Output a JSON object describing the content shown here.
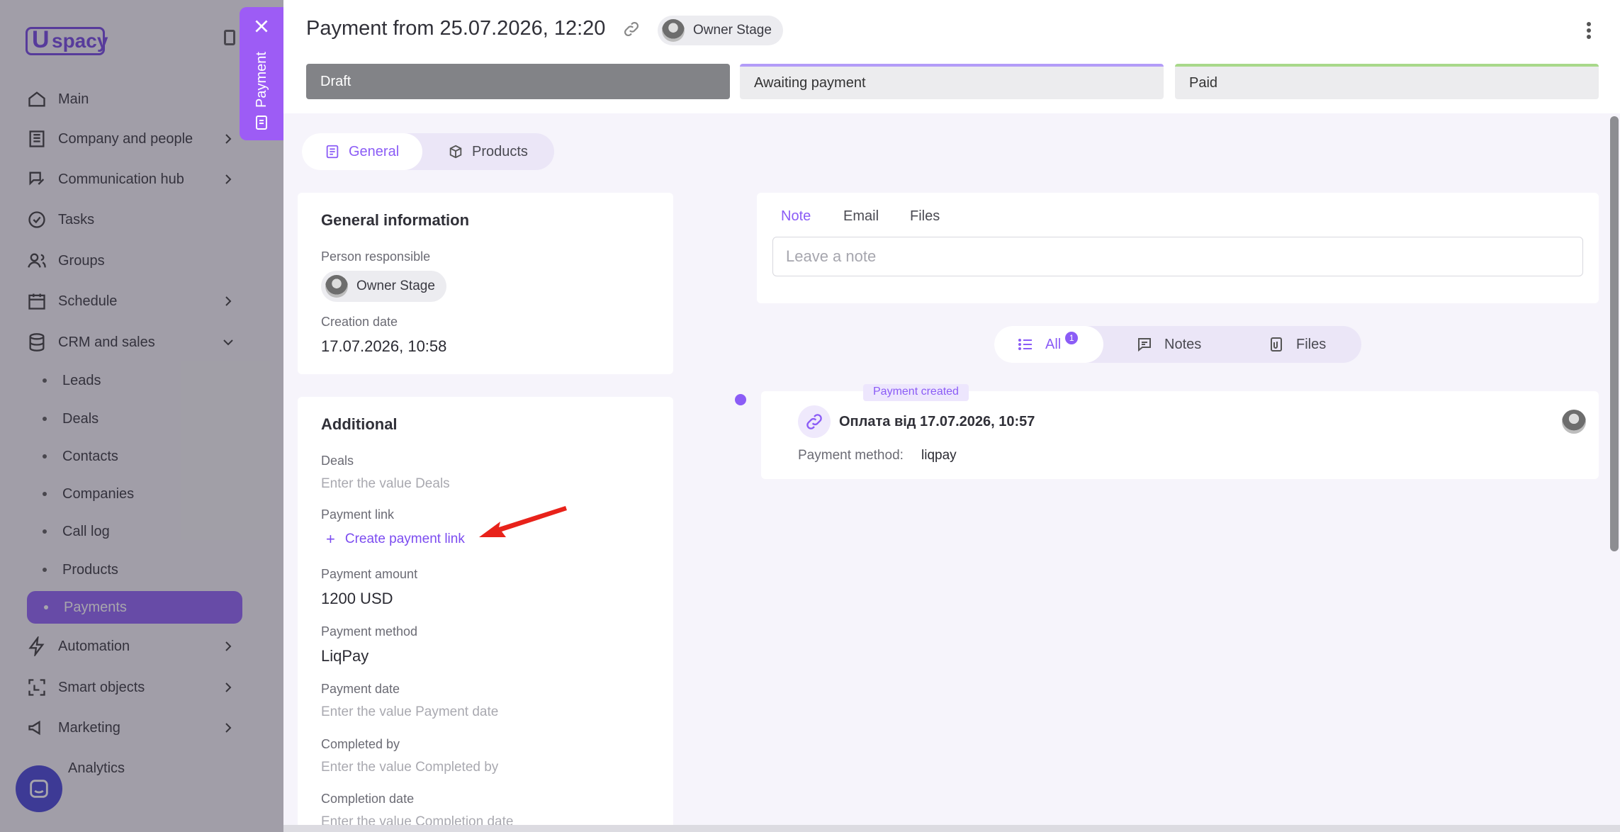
{
  "sidebar": {
    "logo": "spacy",
    "logo_u": "U",
    "items": [
      {
        "label": "Main",
        "icon": "home-icon"
      },
      {
        "label": "Company and people",
        "icon": "building-icon"
      },
      {
        "label": "Communication hub",
        "icon": "chat-edit-icon"
      },
      {
        "label": "Tasks",
        "icon": "check-circle-icon"
      },
      {
        "label": "Groups",
        "icon": "users-icon"
      },
      {
        "label": "Schedule",
        "icon": "calendar-icon"
      },
      {
        "label": "CRM and sales",
        "icon": "database-icon"
      },
      {
        "label": "Automation",
        "icon": "lightning-icon"
      },
      {
        "label": "Smart objects",
        "icon": "smart-object-icon"
      },
      {
        "label": "Marketing",
        "icon": "megaphone-icon"
      },
      {
        "label": "Analytics",
        "icon": "chart-icon"
      }
    ],
    "crm_sub": [
      "Leads",
      "Deals",
      "Contacts",
      "Companies",
      "Call log",
      "Products",
      "Payments"
    ]
  },
  "side_tab": {
    "label": "Payment"
  },
  "header": {
    "title": "Payment from 25.07.2026, 12:20",
    "owner": "Owner Stage"
  },
  "stages": {
    "draft": "Draft",
    "awaiting": "Awaiting payment",
    "paid": "Paid"
  },
  "tabs": {
    "general": "General",
    "products": "Products"
  },
  "general_info": {
    "title": "General information",
    "person_label": "Person responsible",
    "person": "Owner Stage",
    "creation_label": "Creation date",
    "creation": "17.07.2026, 10:58"
  },
  "additional": {
    "title": "Additional",
    "deals_label": "Deals",
    "deals_placeholder": "Enter the value Deals",
    "link_label": "Payment link",
    "link_action": "Create payment link",
    "amount_label": "Payment amount",
    "amount": "1200 USD",
    "method_label": "Payment method",
    "method": "LiqPay",
    "date_label": "Payment date",
    "date_placeholder": "Enter the value Payment date",
    "completed_label": "Completed by",
    "completed_placeholder": "Enter the value Completed by",
    "completion_label": "Completion date",
    "completion_placeholder": "Enter the value Completion date"
  },
  "note": {
    "tabs": [
      "Note",
      "Email",
      "Files"
    ],
    "placeholder": "Leave a note"
  },
  "filter": {
    "all": "All",
    "all_count": "1",
    "notes": "Notes",
    "files": "Files"
  },
  "event": {
    "tag": "Payment created",
    "title": "Оплата від 17.07.2026, 10:57",
    "method_label": "Payment method:",
    "method_value": "liqpay"
  },
  "colors": {
    "accent": "#8b5cf6",
    "draft": "#828387",
    "awaiting_border": "#b39cf8",
    "paid_border": "#a8d88a"
  }
}
